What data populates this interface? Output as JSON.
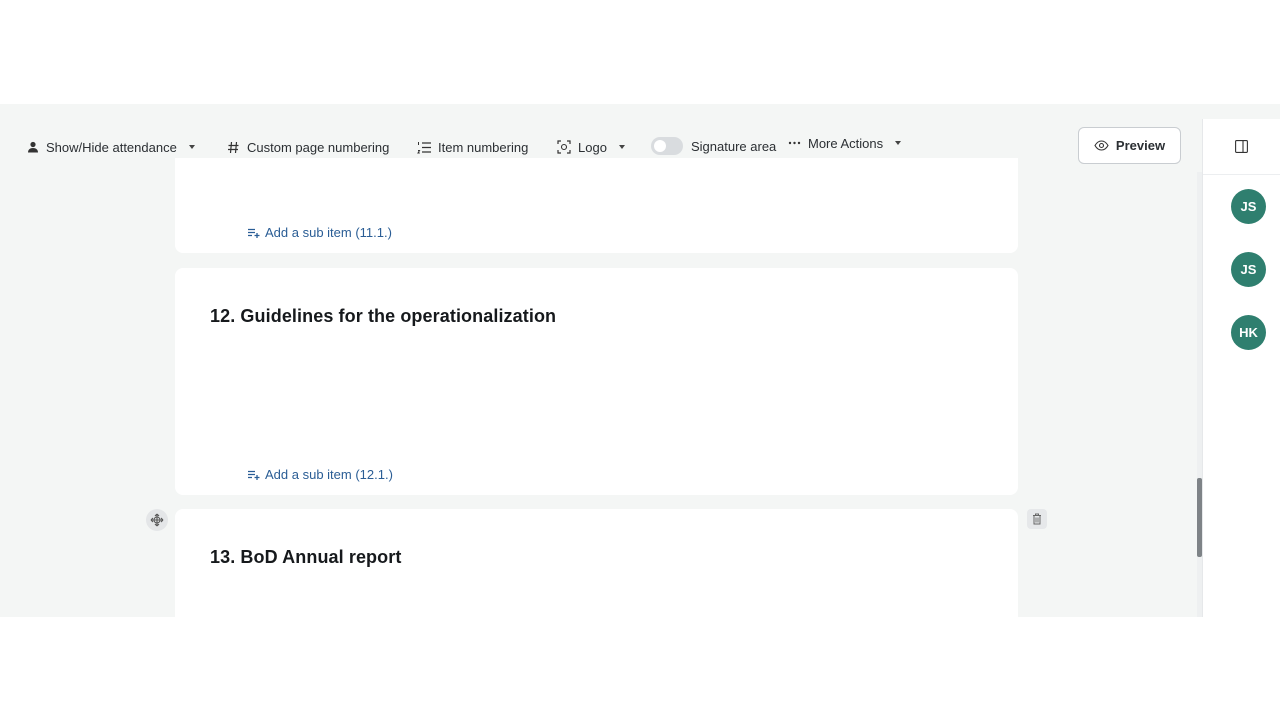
{
  "toolbar": {
    "attendance_label": "Show/Hide attendance",
    "page_numbering_label": "Custom page numbering",
    "item_numbering_label": "Item numbering",
    "logo_label": "Logo",
    "signature_label": "Signature area",
    "more_actions_label": "More Actions",
    "preview_label": "Preview"
  },
  "participants": [
    {
      "initials": "JS"
    },
    {
      "initials": "JS"
    },
    {
      "initials": "HK"
    }
  ],
  "items": [
    {
      "add_sub_label": "Add a sub item (11.1.)"
    },
    {
      "title": "12. Guidelines for the operationalization",
      "add_sub_label": "Add a sub item (12.1.)"
    },
    {
      "title": "13. BoD Annual report"
    }
  ],
  "colors": {
    "accent": "#2a5d95",
    "avatar": "#2f7f6f",
    "canvas": "#f4f6f5"
  }
}
